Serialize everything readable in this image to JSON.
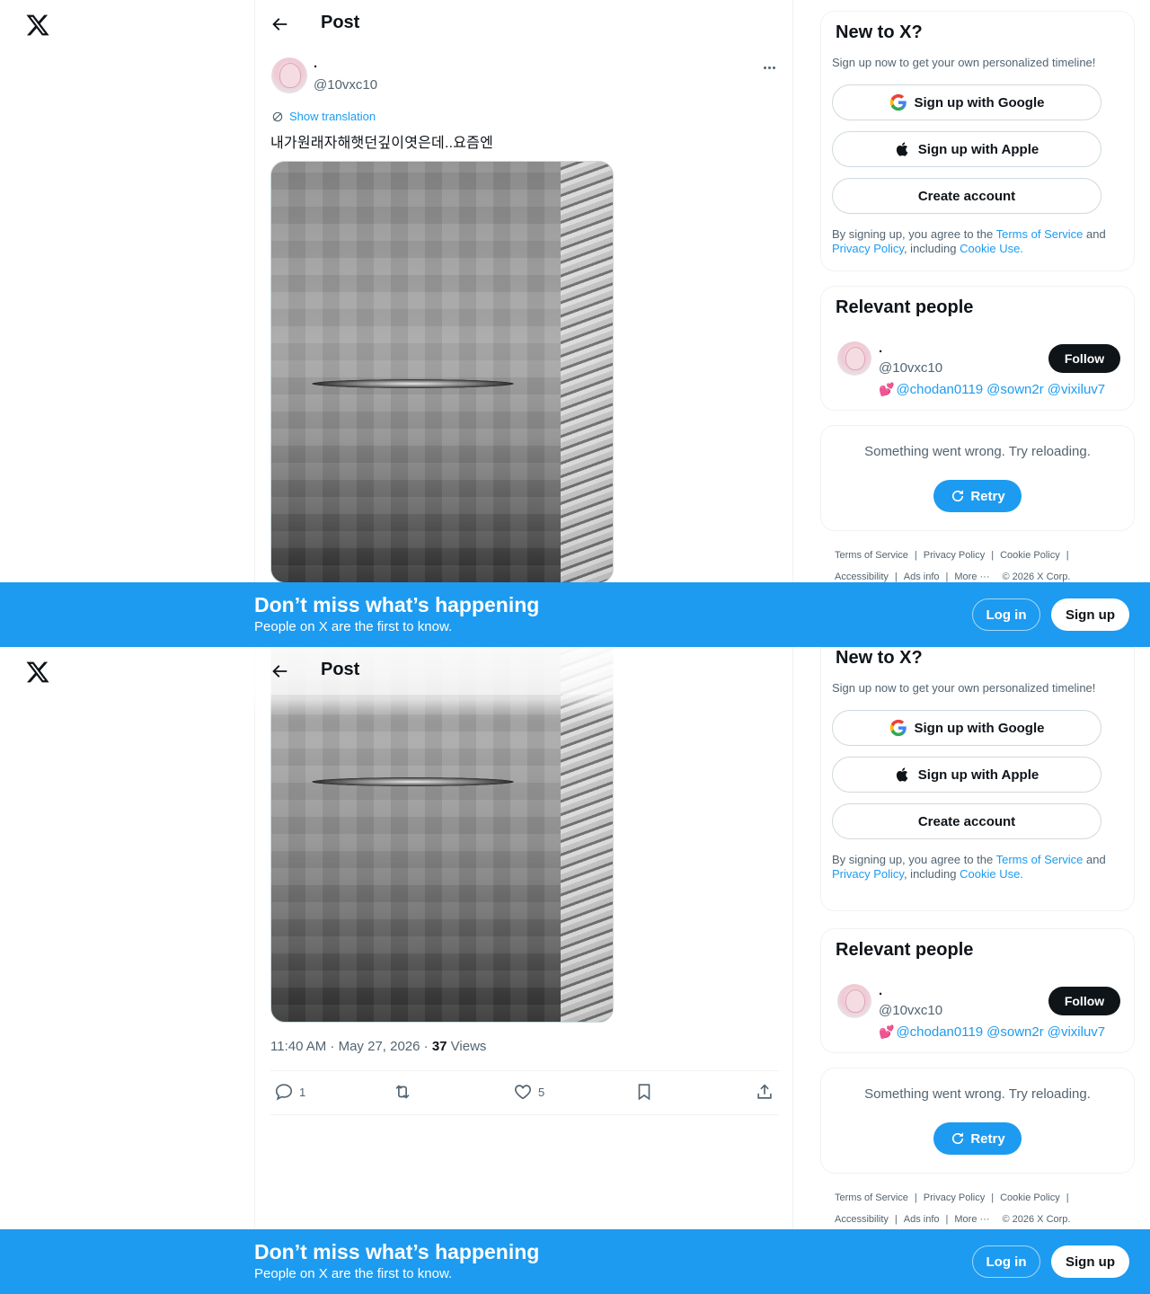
{
  "header": {
    "title": "Post"
  },
  "post": {
    "author_name": ".",
    "author_handle": "@10vxc10",
    "show_translation": "Show translation",
    "text": "내가원래자해햇던깊이엿은데..요즘엔",
    "time": "11:40 AM · May 27, 2026 · ",
    "views_count": "37",
    "views_label": " Views",
    "replies": "1",
    "reposts": "",
    "likes": "5"
  },
  "signup_card": {
    "title": "New to X?",
    "subtitle": "Sign up now to get your own personalized timeline!",
    "google": "Sign up with Google",
    "apple": "Sign up with Apple",
    "create": "Create account",
    "legal_1": "By signing up, you agree to the ",
    "terms": "Terms of Service",
    "legal_2": " and ",
    "privacy": "Privacy Policy",
    "legal_3": ", including ",
    "cookie": "Cookie Use."
  },
  "relevant": {
    "title": "Relevant people",
    "name": ".",
    "handle": "@10vxc10",
    "heart": "💕",
    "mentions": [
      "@chodan0119",
      "@sown2r",
      "@vixiluv7"
    ],
    "follow": "Follow"
  },
  "error_card": {
    "message": "Something went wrong. Try reloading.",
    "retry": "Retry"
  },
  "footer": {
    "terms": "Terms of Service",
    "privacy": "Privacy Policy",
    "cookie": "Cookie Policy",
    "accessibility": "Accessibility",
    "ads": "Ads info",
    "more": "More ···",
    "copyright": "© 2026 X Corp."
  },
  "banner": {
    "title": "Don’t miss what’s happening",
    "subtitle": "People on X are the first to know.",
    "login": "Log in",
    "signup": "Sign up"
  },
  "colors": {
    "accent": "#1d9bf0",
    "text": "#0f1419",
    "muted": "#536471"
  }
}
